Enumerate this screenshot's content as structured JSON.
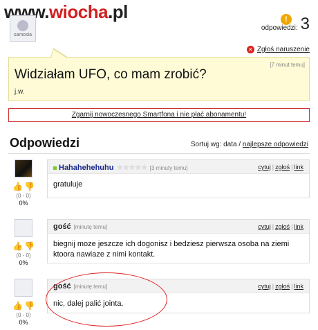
{
  "watermark": {
    "prefix": "www.",
    "brand": "wiocha",
    "suffix": ".pl"
  },
  "top_avatar_label": "samosia",
  "answers_count": {
    "icon": "question-icon",
    "label": "odpowiedzi:",
    "value": "3"
  },
  "report": {
    "icon": "close-icon",
    "label": "Zgłoś naruszenie"
  },
  "question": {
    "time": "[7 minut temu]",
    "title": "Widziałam UFO, co mam zrobić?",
    "body": "j.w."
  },
  "promo": "Zgarnij nowoczesnego Smartfona  i nie płać abonamentu!",
  "answers_section": {
    "title": "Odpowiedzi",
    "sort_label": "Sortuj wg: data /",
    "sort_best": "najlepsze odpowiedzi"
  },
  "actions": {
    "quote": "cytuj",
    "report": "zgłoś",
    "link": "link",
    "sep": "|"
  },
  "answers": [
    {
      "author": "Hahahehehuhu",
      "time": "[3 minuty temu]",
      "text": "gratuluje",
      "score": "(0 - 0)",
      "percent": "0%"
    },
    {
      "author": "gość",
      "time": "[minutę temu]",
      "text": "biegnij moze jeszcze ich dogonisz i bedziesz pierwsza osoba na ziemi ktoora nawiaze z nimi kontakt.",
      "score": "(0 - 0)",
      "percent": "0%"
    },
    {
      "author": "gość",
      "time": "[minutę temu]",
      "text": "nic, dalej palić jointa.",
      "score": "(0 - 0)",
      "percent": "0%"
    }
  ],
  "colors": {
    "accent_red": "#d12020",
    "question_bg": "#fffbd6",
    "thumb_up": "#b04ac0",
    "thumb_down": "#e2b000"
  }
}
